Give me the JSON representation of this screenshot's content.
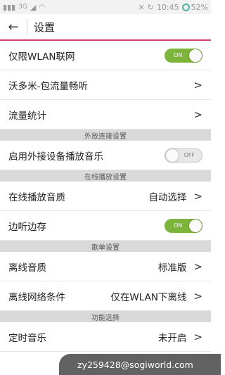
{
  "status_bar": {
    "network": "3G",
    "time": "10:45",
    "battery": "52%"
  },
  "header": {
    "title": "设置",
    "back_icon": "arrow-left-icon"
  },
  "rows": {
    "wlan_only": {
      "label": "仅限WLAN联网",
      "toggle": "ON"
    },
    "data_package": {
      "label": "沃多米-包流量畅听"
    },
    "traffic_stats": {
      "label": "流量统计"
    },
    "external_section": "外放连接设置",
    "external_play": {
      "label": "启用外接设备播放音乐",
      "toggle": "OFF"
    },
    "online_section": "在线播放设置",
    "online_quality": {
      "label": "在线播放音质",
      "value": "自动选择"
    },
    "listen_cache": {
      "label": "边听边存",
      "toggle": "ON"
    },
    "playlist_section": "歌单设置",
    "offline_quality": {
      "label": "离线音质",
      "value": "标准版"
    },
    "offline_network": {
      "label": "离线网络条件",
      "value": "仅在WLAN下离线"
    },
    "feature_section": "功能选择",
    "timer_music": {
      "label": "定时音乐",
      "value": "未开启"
    }
  },
  "chevron": ">",
  "watermark": "zy259428@sogiworld.com",
  "colors": {
    "accent": "#d6426a",
    "toggle_on": "#7db43a",
    "section_bg": "#d9d9d9"
  }
}
